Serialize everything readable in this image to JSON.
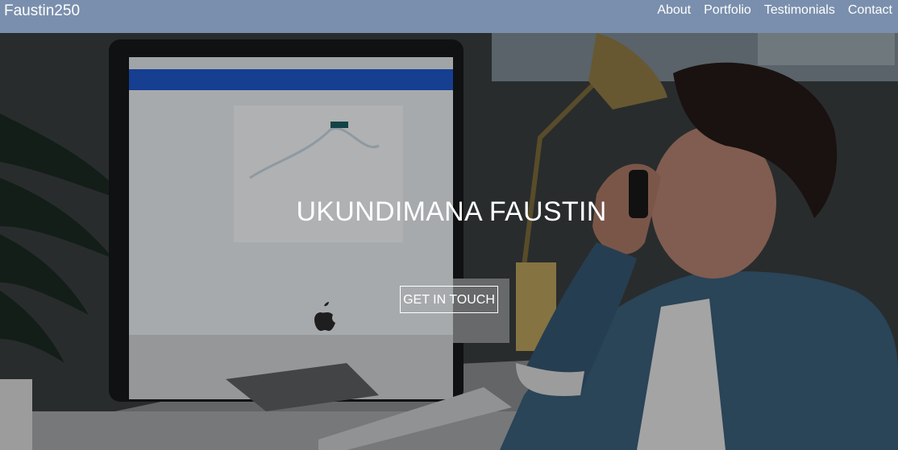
{
  "navbar": {
    "brand": "Faustin250",
    "links": [
      "About",
      "Portfolio",
      "Testimonials",
      "Contact"
    ],
    "background": "#7a8fad"
  },
  "hero": {
    "title": "UKUNDIMANA FAUSTIN",
    "cta_label": "GET IN TOUCH",
    "background_image": "man on phone at desk with iMac",
    "icons": [
      "apple-logo-icon"
    ]
  }
}
